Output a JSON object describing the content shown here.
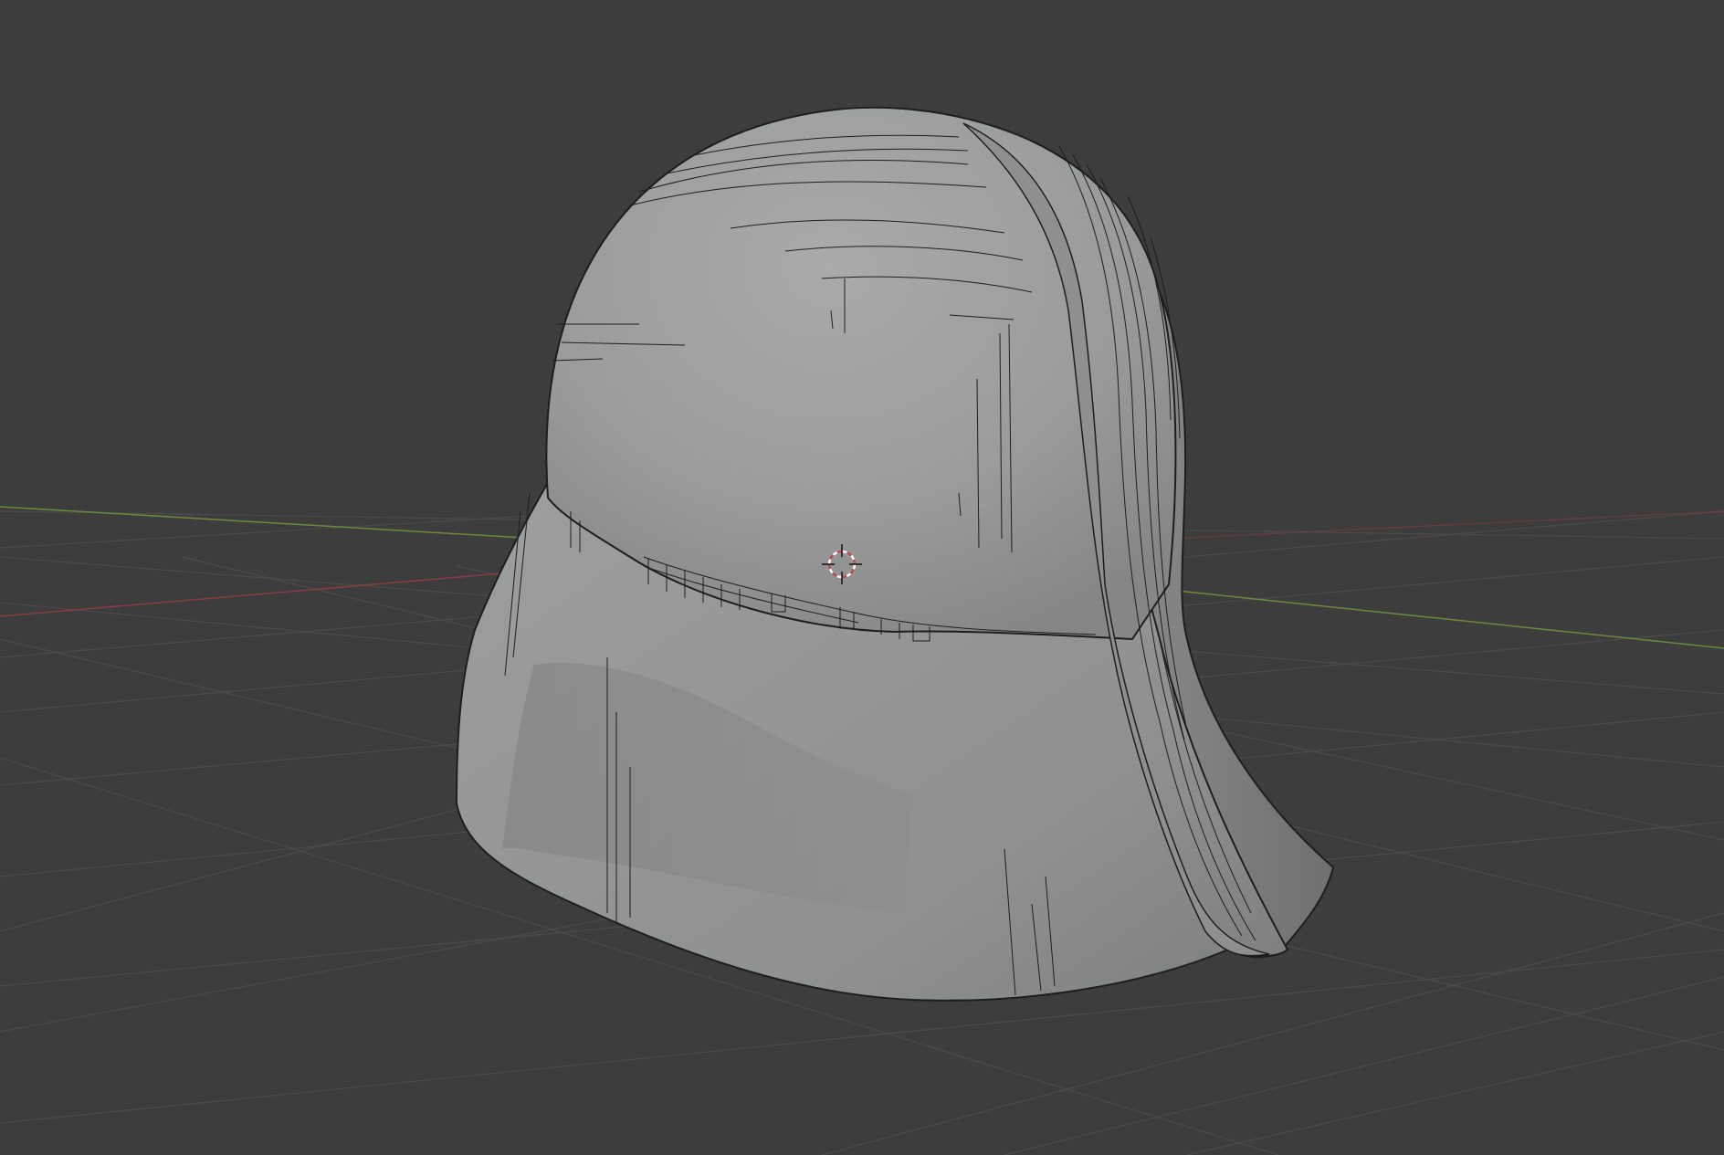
{
  "viewport": {
    "background_color": "#3d3d3d",
    "grid_color": "#4c4c4c",
    "x_axis_color": "#8a3c42",
    "y_axis_color": "#6a8a3a"
  },
  "object": {
    "shading": "solid",
    "base_color": "#9a9c9c",
    "wireframe_color": "#1e1e1e"
  },
  "cursor_3d": {
    "icon": "3d-cursor-icon",
    "ring_color_a": "#c24a4a",
    "ring_color_b": "#ffffff"
  }
}
